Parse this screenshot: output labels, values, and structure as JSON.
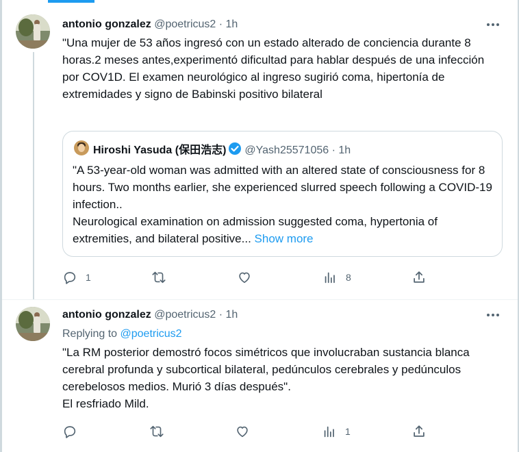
{
  "tweets": [
    {
      "name": "antonio gonzalez",
      "handle": "@poetricus2",
      "sep": "·",
      "time": "1h",
      "text": "\"Una mujer de 53 años ingresó con un estado alterado de conciencia durante 8 horas.2 meses antes,experimentó dificultad para hablar después de una infección por COV1D. El examen neurológico al ingreso sugirió coma, hipertonía de extremidades y signo de Babinski positivo bilateral",
      "quote": {
        "name": "Hiroshi Yasuda (保田浩志)",
        "handle": "@Yash25571056",
        "sep": "·",
        "time": "1h",
        "text": "\"A 53-year-old woman was admitted with an altered state of consciousness for 8 hours. Two months earlier, she experienced slurred speech following a COVID-19 infection..\nNeurological examination on admission suggested coma, hypertonia of extremities, and bilateral positive...",
        "show_more": "Show more"
      },
      "actions": {
        "replies": "1",
        "retweets": "",
        "likes": "",
        "views": "8"
      }
    },
    {
      "name": "antonio gonzalez",
      "handle": "@poetricus2",
      "sep": "·",
      "time": "1h",
      "replying_prefix": "Replying to",
      "replying_handle": "@poetricus2",
      "text": "\"La RM posterior demostró focos simétricos que involucraban sustancia blanca cerebral profunda y subcortical bilateral, pedúnculos cerebrales y pedúnculos cerebelosos medios. Murió 3 días después\".\nEl resfriado Mild.",
      "actions": {
        "replies": "",
        "retweets": "",
        "likes": "",
        "views": "1"
      }
    }
  ],
  "colors": {
    "accent": "#1d9bf0",
    "secondary_text": "#536471",
    "border": "#cfd9de",
    "verified": "#1d9bf0"
  },
  "icons": [
    "more-icon",
    "verified-icon",
    "reply-icon",
    "retweet-icon",
    "like-icon",
    "views-icon",
    "share-icon"
  ]
}
